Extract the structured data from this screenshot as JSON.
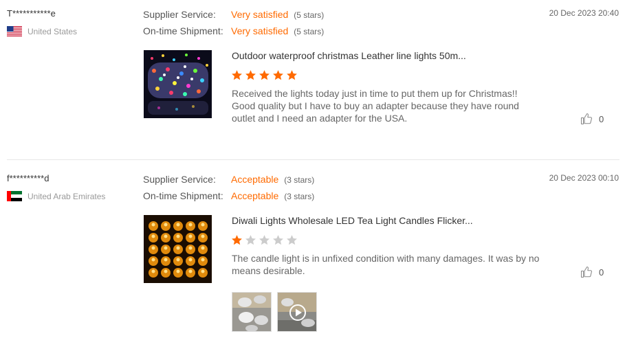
{
  "reviews": [
    {
      "buyer": "T***********e",
      "country": "United States",
      "supplier_service_label": "Supplier Service:",
      "supplier_service_value": "Very satisfied",
      "supplier_service_stars": "(5 stars)",
      "shipment_label": "On-time Shipment:",
      "shipment_value": "Very satisfied",
      "shipment_stars": "(5 stars)",
      "date": "20 Dec 2023 20:40",
      "product_title": "Outdoor waterproof christmas Leather line lights 50m...",
      "rating": 5,
      "text": "Received the lights today just in time to put them up for Christmas!! Good quality but I have to buy an adapter because they have round outlet and I need an adapter for the USA.",
      "likes": "0"
    },
    {
      "buyer": "f**********d",
      "country": "United Arab Emirates",
      "supplier_service_label": "Supplier Service:",
      "supplier_service_value": "Acceptable",
      "supplier_service_stars": "(3 stars)",
      "shipment_label": "On-time Shipment:",
      "shipment_value": "Acceptable",
      "shipment_stars": "(3 stars)",
      "date": "20 Dec 2023 00:10",
      "product_title": "Diwali Lights Wholesale LED Tea Light Candles Flicker...",
      "rating": 1,
      "text": "The candle light is in unfixed condition with many damages.  It was by no means desirable.",
      "likes": "0"
    }
  ],
  "colors": {
    "accent": "#ff6a00",
    "star_empty": "#cccccc",
    "divider": "#e6e6e6"
  },
  "icons": [
    "us-flag-icon",
    "uae-flag-icon",
    "thumbs-up-icon",
    "star-icon",
    "play-icon"
  ]
}
